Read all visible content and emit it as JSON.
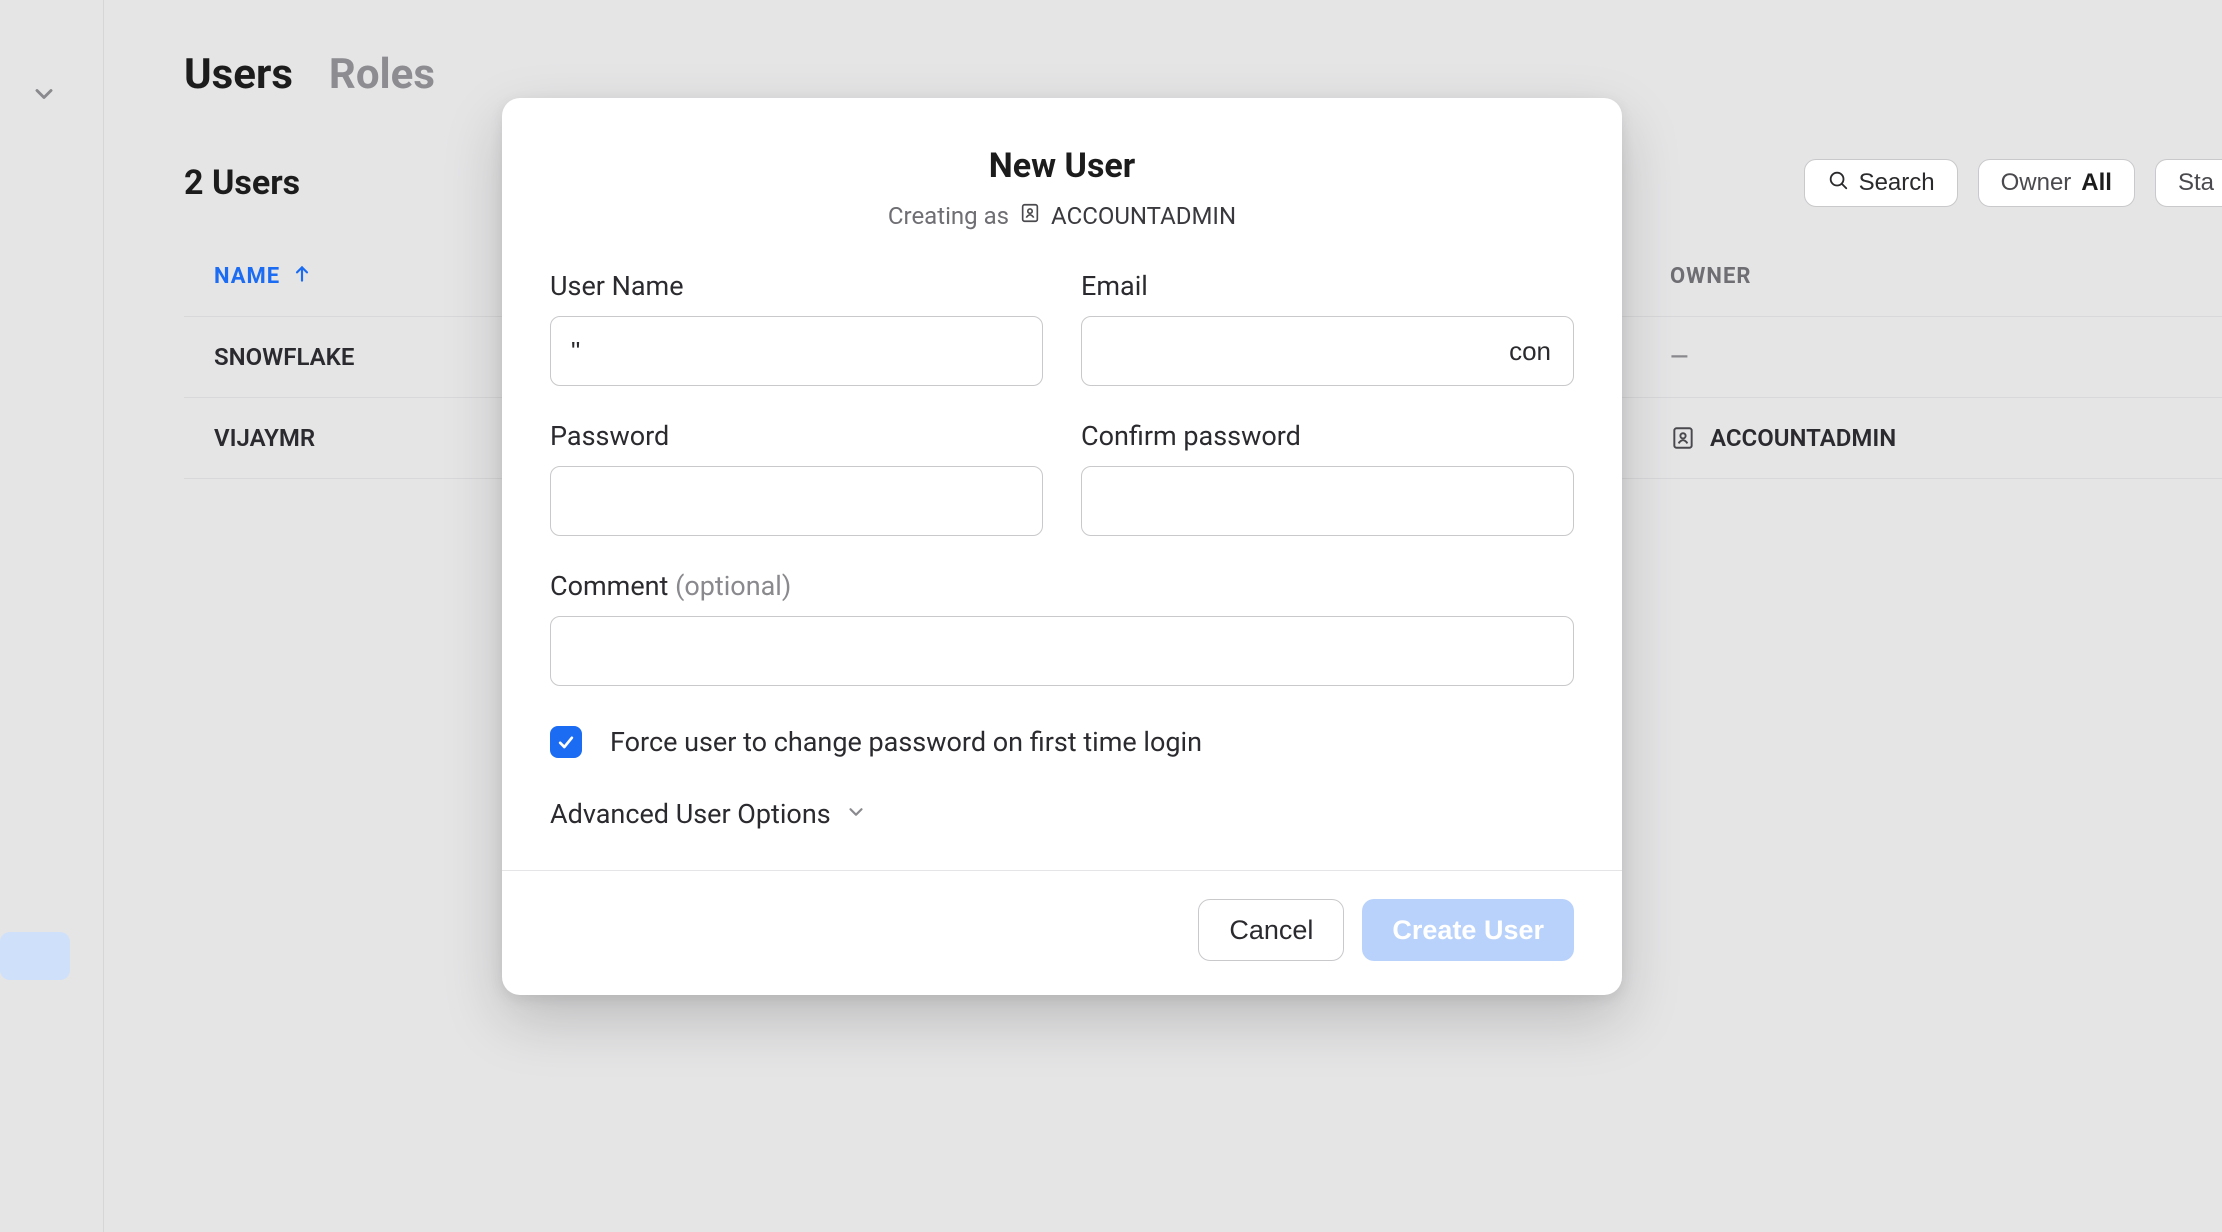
{
  "tabs": {
    "users": "Users",
    "roles": "Roles"
  },
  "count_label": "2 Users",
  "toolbar": {
    "search": "Search",
    "owner_label": "Owner",
    "owner_value": "All",
    "status_partial": "Sta"
  },
  "table": {
    "columns": {
      "name": "NAME",
      "owner": "OWNER"
    },
    "rows": [
      {
        "name": "SNOWFLAKE",
        "owner": "—"
      },
      {
        "name": "VIJAYMR",
        "owner": "ACCOUNTADMIN"
      }
    ]
  },
  "modal": {
    "title": "New User",
    "creating_as_label": "Creating as",
    "creating_as_role": "ACCOUNTADMIN",
    "fields": {
      "username_label": "User Name",
      "username_value": "\"",
      "email_label": "Email",
      "email_value": "con",
      "password_label": "Password",
      "confirm_label": "Confirm password",
      "comment_label": "Comment",
      "comment_optional": "(optional)"
    },
    "force_change_label": "Force user to change password on first time login",
    "force_change_checked": true,
    "advanced_label": "Advanced User Options",
    "cancel": "Cancel",
    "create": "Create User"
  }
}
